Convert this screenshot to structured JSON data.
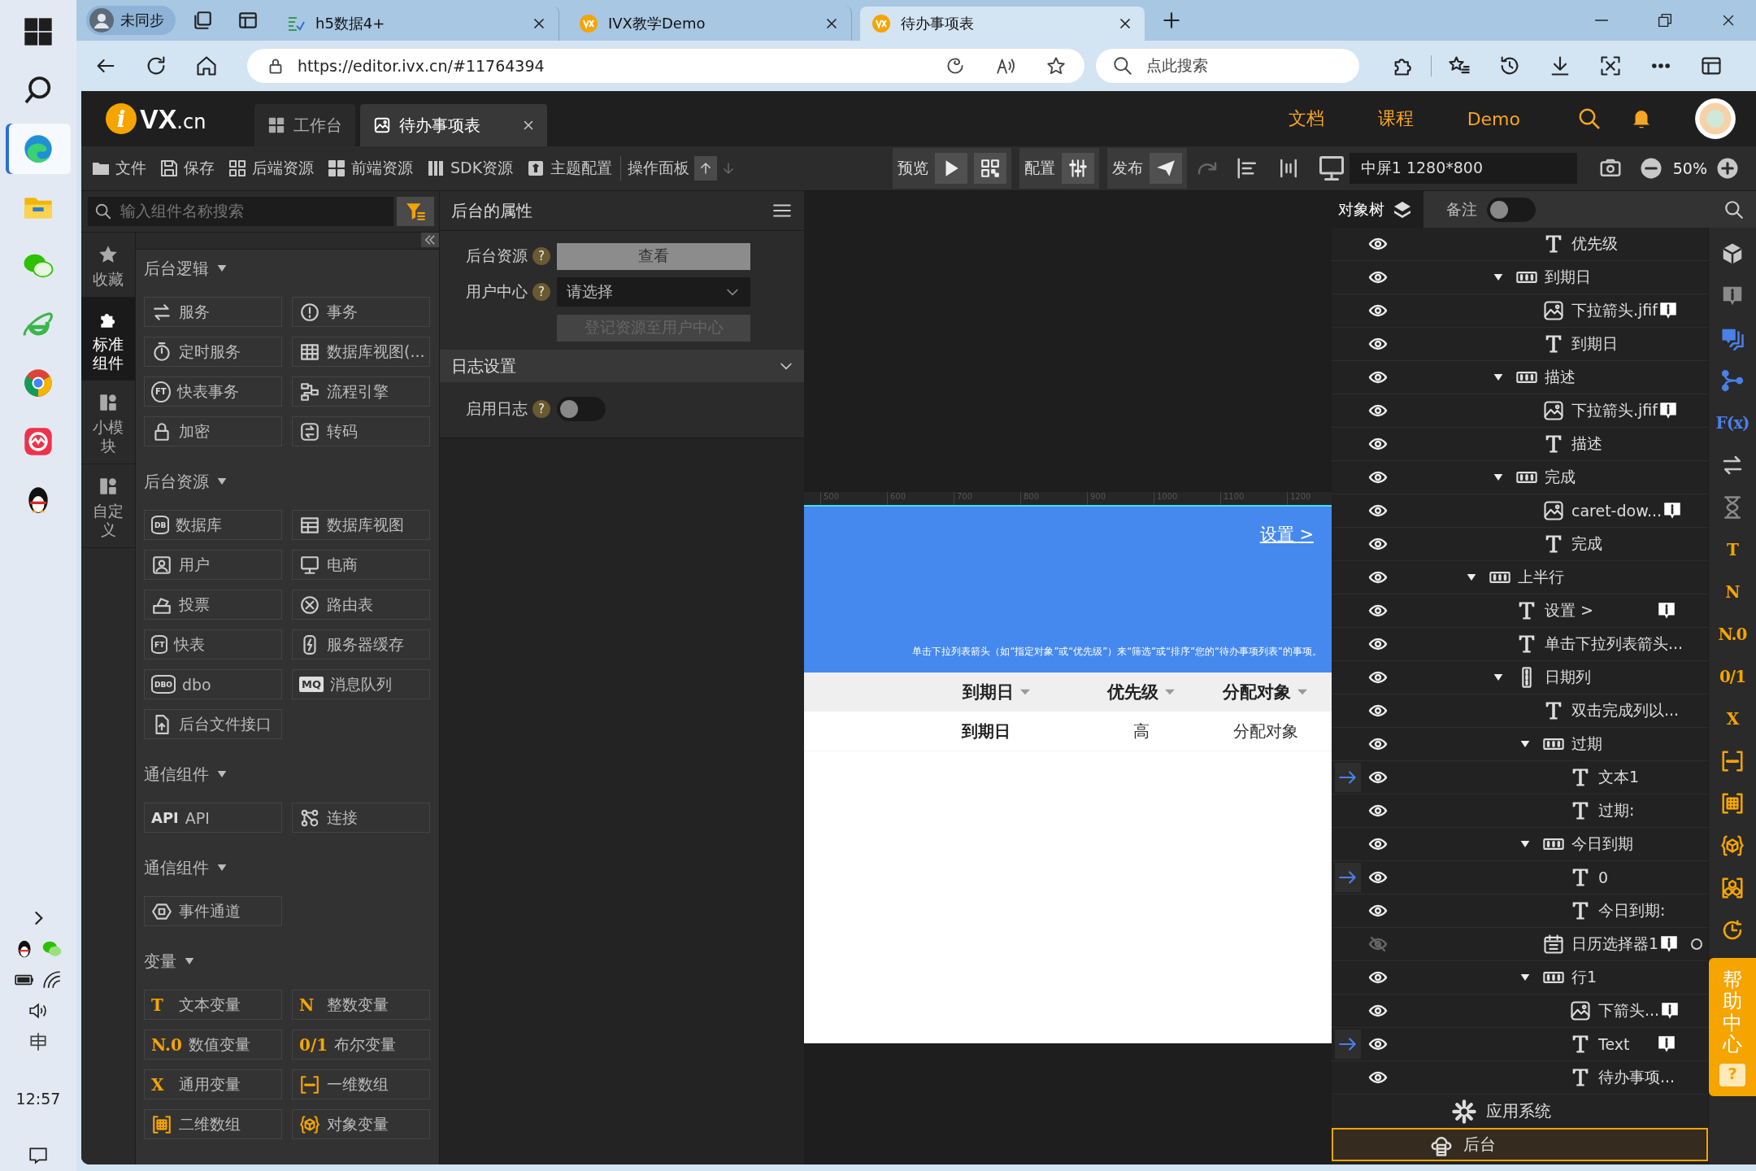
{
  "taskbar": {
    "apps": [
      {
        "kind": "start",
        "selected": false
      },
      {
        "kind": "search",
        "selected": false
      },
      {
        "kind": "edge",
        "selected": true
      },
      {
        "kind": "files",
        "selected": false
      },
      {
        "kind": "chat",
        "selected": false
      },
      {
        "kind": "ie",
        "selected": false
      },
      {
        "kind": "chrome",
        "selected": false
      },
      {
        "kind": "red-app",
        "selected": false
      },
      {
        "kind": "penguin",
        "selected": false
      }
    ],
    "time": "12:57"
  },
  "browser": {
    "profile": "未同步",
    "tabs": [
      {
        "title": "h5数据4+",
        "selected": false
      },
      {
        "title": "IVX教学Demo",
        "selected": false
      },
      {
        "title": "待办事项表",
        "selected": true
      }
    ],
    "url": "https://editor.ivx.cn/#11764394",
    "search": {
      "placeholder": "点此搜索"
    }
  },
  "editor": {
    "logo": {
      "mark": "i",
      "name": "VX",
      "suffix": ".cn"
    },
    "tabs": [
      {
        "label": "工作台",
        "selected": false,
        "closable": false
      },
      {
        "label": "待办事项表",
        "selected": true,
        "closable": true
      }
    ],
    "links": [
      "文档",
      "课程",
      "Demo"
    ],
    "toolbar": {
      "items": [
        {
          "label": "文件"
        },
        {
          "label": "保存"
        },
        {
          "label": "后端资源"
        },
        {
          "label": "前端资源"
        },
        {
          "label": "SDK资源"
        },
        {
          "label": "主题配置"
        },
        {
          "label": "操作面板"
        }
      ],
      "preview": "预览",
      "config": "配置",
      "publish": "发布",
      "screen": "中屏1 1280*800",
      "zoom": "50%"
    }
  },
  "components": {
    "search": {
      "placeholder": "输入组件名称搜索"
    },
    "categories": [
      {
        "label": "收藏",
        "selected": false
      },
      {
        "label": "标准组件",
        "selected": true
      },
      {
        "label": "小模块",
        "selected": false
      },
      {
        "label": "自定义",
        "selected": false
      }
    ],
    "sections": [
      {
        "title": "后台逻辑",
        "expanded": true,
        "accent": false,
        "items": [
          {
            "label": "服务",
            "kind": "swap"
          },
          {
            "label": "事务",
            "kind": "alert"
          },
          {
            "label": "定时服务",
            "kind": "timer"
          },
          {
            "label": "数据库视图(...",
            "kind": "grid"
          },
          {
            "label": "快表事务",
            "kind": "ring",
            "glyph": "FT"
          },
          {
            "label": "流程引擎",
            "kind": "flow"
          },
          {
            "label": "加密",
            "kind": "lock"
          },
          {
            "label": "转码",
            "kind": "convert"
          }
        ]
      },
      {
        "title": "后台资源",
        "expanded": true,
        "accent": false,
        "items": [
          {
            "label": "数据库",
            "kind": "can",
            "glyph": "DB"
          },
          {
            "label": "数据库视图",
            "kind": "table"
          },
          {
            "label": "用户",
            "kind": "user"
          },
          {
            "label": "电商",
            "kind": "monitor"
          },
          {
            "label": "投票",
            "kind": "ballot"
          },
          {
            "label": "路由表",
            "kind": "route"
          },
          {
            "label": "快表",
            "kind": "can",
            "glyph": "FT"
          },
          {
            "label": "服务器缓存",
            "kind": "cache"
          },
          {
            "label": "dbo",
            "kind": "can",
            "glyph": "DBO"
          },
          {
            "label": "消息队列",
            "kind": "tag",
            "glyph": "MQ"
          },
          {
            "label": "后台文件接口",
            "kind": "file-up"
          }
        ]
      },
      {
        "title": "通信组件",
        "expanded": true,
        "accent": false,
        "items": [
          {
            "label": "API",
            "kind": "plain",
            "glyph": "API"
          },
          {
            "label": "连接",
            "kind": "nodes"
          }
        ]
      },
      {
        "title": "通信组件",
        "expanded": true,
        "accent": false,
        "items": [
          {
            "label": "事件通道",
            "kind": "hexagon"
          }
        ]
      },
      {
        "title": "变量",
        "expanded": true,
        "accent": true,
        "items": [
          {
            "label": "文本变量",
            "kind": "var",
            "glyph": "T"
          },
          {
            "label": "整数变量",
            "kind": "var",
            "glyph": "N"
          },
          {
            "label": "数值变量",
            "kind": "var",
            "glyph": "N.0"
          },
          {
            "label": "布尔变量",
            "kind": "var",
            "glyph": "0/1"
          },
          {
            "label": "通用变量",
            "kind": "var",
            "glyph": "X"
          },
          {
            "label": "一维数组",
            "kind": "bracket-dots"
          },
          {
            "label": "二维数组",
            "kind": "bracket-grid"
          },
          {
            "label": "对象变量",
            "kind": "cube-braces"
          }
        ]
      }
    ]
  },
  "properties": {
    "title": "后台的属性",
    "fields": [
      {
        "label": "后台资源",
        "help": "?",
        "kind": "button",
        "value": "查看",
        "disabled": false
      },
      {
        "label": "用户中心",
        "help": "?",
        "kind": "select",
        "placeholder": "请选择",
        "disabled": false
      },
      {
        "kind": "button",
        "value": "登记资源至用户中心",
        "disabled": true
      }
    ],
    "section": {
      "title": "日志设置",
      "expanded": true,
      "fields": [
        {
          "label": "启用日志",
          "help": "?",
          "kind": "toggle",
          "on": false
        }
      ]
    }
  },
  "canvas": {
    "ruler": [
      "500",
      "600",
      "700",
      "800",
      "900",
      "1000",
      "1100",
      "1200"
    ],
    "page": {
      "link": "设置 >",
      "hint": "单击下拉列表箭头（如“指定对象”或“优先级”）来“筛选”或“排序”您的“待办事项列表”的事项。",
      "columns": [
        "到期日",
        "优先级",
        "分配对象"
      ],
      "row": [
        "到期日",
        "高",
        "分配对象"
      ]
    }
  },
  "object_tree": {
    "tabs": [
      {
        "label": "对象树",
        "selected": true
      }
    ],
    "note_toggle": {
      "label": "备注",
      "on": false
    },
    "nodes": [
      {
        "children": [
          {
            "children": [
              {
                "label": "优先级",
                "kind": "text",
                "visible": true,
                "linked": false,
                "note": false,
                "dot": false
              }
            ]
          },
          {
            "label": "到期日",
            "kind": "group",
            "expanded": true,
            "visible": true,
            "linked": false,
            "note": false,
            "dot": false,
            "children": [
              {
                "label": "下拉箭头.jfif",
                "kind": "image",
                "visible": true,
                "linked": false,
                "note": true,
                "dot": false
              },
              {
                "label": "到期日",
                "kind": "text",
                "visible": true,
                "linked": false,
                "note": false,
                "dot": false
              }
            ]
          },
          {
            "label": "描述",
            "kind": "group",
            "expanded": true,
            "visible": true,
            "linked": false,
            "note": false,
            "dot": false,
            "children": [
              {
                "label": "下拉箭头.jfif",
                "kind": "image",
                "visible": true,
                "linked": false,
                "note": true,
                "dot": false
              },
              {
                "label": "描述",
                "kind": "text",
                "visible": true,
                "linked": false,
                "note": false,
                "dot": false
              }
            ]
          },
          {
            "label": "完成",
            "kind": "group",
            "expanded": true,
            "visible": true,
            "linked": false,
            "note": false,
            "dot": false,
            "children": [
              {
                "label": "caret-dow...",
                "kind": "image",
                "visible": true,
                "linked": false,
                "note": true,
                "dot": false
              },
              {
                "label": "完成",
                "kind": "text",
                "visible": true,
                "linked": false,
                "note": false,
                "dot": false
              }
            ]
          }
        ]
      },
      {
        "label": "上半行",
        "kind": "group",
        "expanded": true,
        "visible": true,
        "linked": false,
        "note": false,
        "dot": false,
        "children": [
          {
            "label": "设置 >",
            "kind": "text",
            "visible": true,
            "linked": false,
            "note": true,
            "dot": false
          },
          {
            "label": "单击下拉列表箭头...",
            "kind": "text",
            "visible": true,
            "linked": false,
            "note": false,
            "dot": false
          },
          {
            "label": "日期列",
            "kind": "column",
            "expanded": true,
            "visible": true,
            "linked": false,
            "note": false,
            "dot": false,
            "children": [
              {
                "label": "双击完成列以...",
                "kind": "text",
                "visible": true,
                "linked": false,
                "note": false,
                "dot": false
              },
              {
                "label": "过期",
                "kind": "group",
                "expanded": true,
                "visible": true,
                "linked": false,
                "note": false,
                "dot": false,
                "children": [
                  {
                    "label": "文本1",
                    "kind": "text",
                    "visible": true,
                    "linked": true,
                    "note": false,
                    "dot": false
                  },
                  {
                    "label": "过期:",
                    "kind": "text",
                    "visible": true,
                    "linked": false,
                    "note": false,
                    "dot": false
                  }
                ]
              },
              {
                "label": "今日到期",
                "kind": "group",
                "expanded": true,
                "visible": true,
                "linked": false,
                "note": false,
                "dot": false,
                "children": [
                  {
                    "label": "0",
                    "kind": "text",
                    "visible": true,
                    "linked": true,
                    "note": false,
                    "dot": false
                  },
                  {
                    "label": "今日到期:",
                    "kind": "text",
                    "visible": true,
                    "linked": false,
                    "note": false,
                    "dot": false
                  }
                ]
              },
              {
                "label": "日历选择器1",
                "kind": "calendar",
                "visible": false,
                "linked": false,
                "note": true,
                "dot": true
              },
              {
                "label": "行1",
                "kind": "group",
                "expanded": true,
                "visible": true,
                "linked": false,
                "note": false,
                "dot": false,
                "children": [
                  {
                    "label": "下箭头...",
                    "kind": "image",
                    "visible": true,
                    "linked": false,
                    "note": true,
                    "dot": false
                  },
                  {
                    "label": "Text",
                    "kind": "text",
                    "visible": true,
                    "linked": true,
                    "note": true,
                    "dot": false
                  },
                  {
                    "label": "待办事项...",
                    "kind": "text",
                    "visible": true,
                    "linked": false,
                    "note": false,
                    "dot": false
                  }
                ]
              }
            ]
          }
        ]
      }
    ],
    "roots": [
      {
        "label": "应用系统",
        "kind": "system",
        "selected": false
      },
      {
        "label": "后台",
        "kind": "backend",
        "selected": true
      }
    ]
  },
  "tool_strip": [
    {
      "kind": "cube",
      "color": "#c8c8c8"
    },
    {
      "kind": "info",
      "color": "#8a8a8a"
    },
    {
      "kind": "info-stack",
      "color": "#4a80e8"
    },
    {
      "kind": "branch",
      "color": "#4a80e8"
    },
    {
      "glyph": "F(x)",
      "color": "#4a80e8"
    },
    {
      "kind": "swap",
      "color": "#c8c8c8"
    },
    {
      "kind": "hourglass",
      "color": "#8a8a8a"
    },
    {
      "glyph": "T",
      "color": "#f5a400"
    },
    {
      "glyph": "N",
      "color": "#f5a400"
    },
    {
      "glyph": "N.0",
      "color": "#f5a400"
    },
    {
      "glyph": "0/1",
      "color": "#f5a400"
    },
    {
      "glyph": "X",
      "color": "#f5a400"
    },
    {
      "kind": "bracket-dots",
      "color": "#f5a400"
    },
    {
      "kind": "bracket-grid",
      "color": "#f5a400"
    },
    {
      "kind": "cube-braces",
      "color": "#f5a400"
    },
    {
      "kind": "cubes",
      "color": "#f5a400"
    },
    {
      "kind": "clock",
      "color": "#f5a400"
    }
  ],
  "help": {
    "label": "帮助中心",
    "mark": "?"
  }
}
